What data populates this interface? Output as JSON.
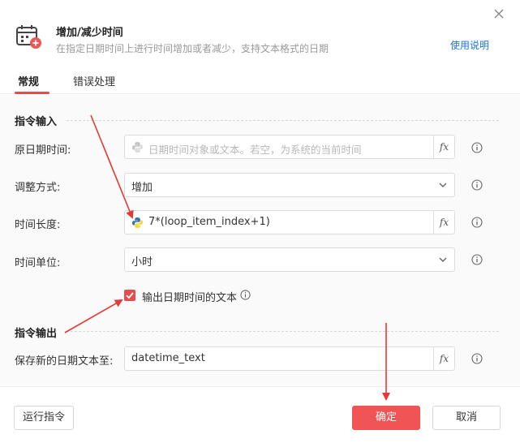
{
  "header": {
    "title": "增加/减少时间",
    "subtitle": "在指定日期时间上进行时间增加或者减少，支持文本格式的日期",
    "help_link": "使用说明",
    "icon": "calendar-add-icon"
  },
  "tabs": [
    {
      "label": "常规",
      "active": true
    },
    {
      "label": "错误处理",
      "active": false
    }
  ],
  "input_section": {
    "title": "指令输入",
    "fields": [
      {
        "label": "原日期时间:",
        "placeholder": "日期时间对象或文本。若空，为系统的当前时间",
        "value": "",
        "kind": "expression"
      },
      {
        "label": "调整方式:",
        "value": "增加",
        "kind": "select"
      },
      {
        "label": "时间长度:",
        "value": "7*(loop_item_index+1)",
        "kind": "expression"
      },
      {
        "label": "时间单位:",
        "value": "小时",
        "kind": "select"
      }
    ],
    "checkbox": {
      "label": "输出日期时间的文本",
      "checked": true
    }
  },
  "output_section": {
    "title": "指令输出",
    "fields": [
      {
        "label": "保存新的日期文本至:",
        "value": "datetime_text",
        "kind": "variable"
      }
    ]
  },
  "fx_label": "fx",
  "footer": {
    "run_label": "运行指令",
    "confirm_label": "确定",
    "cancel_label": "取消"
  },
  "colors": {
    "accent": "#f05454",
    "link": "#1a73e8",
    "annotation_arrow": "#e53935"
  }
}
